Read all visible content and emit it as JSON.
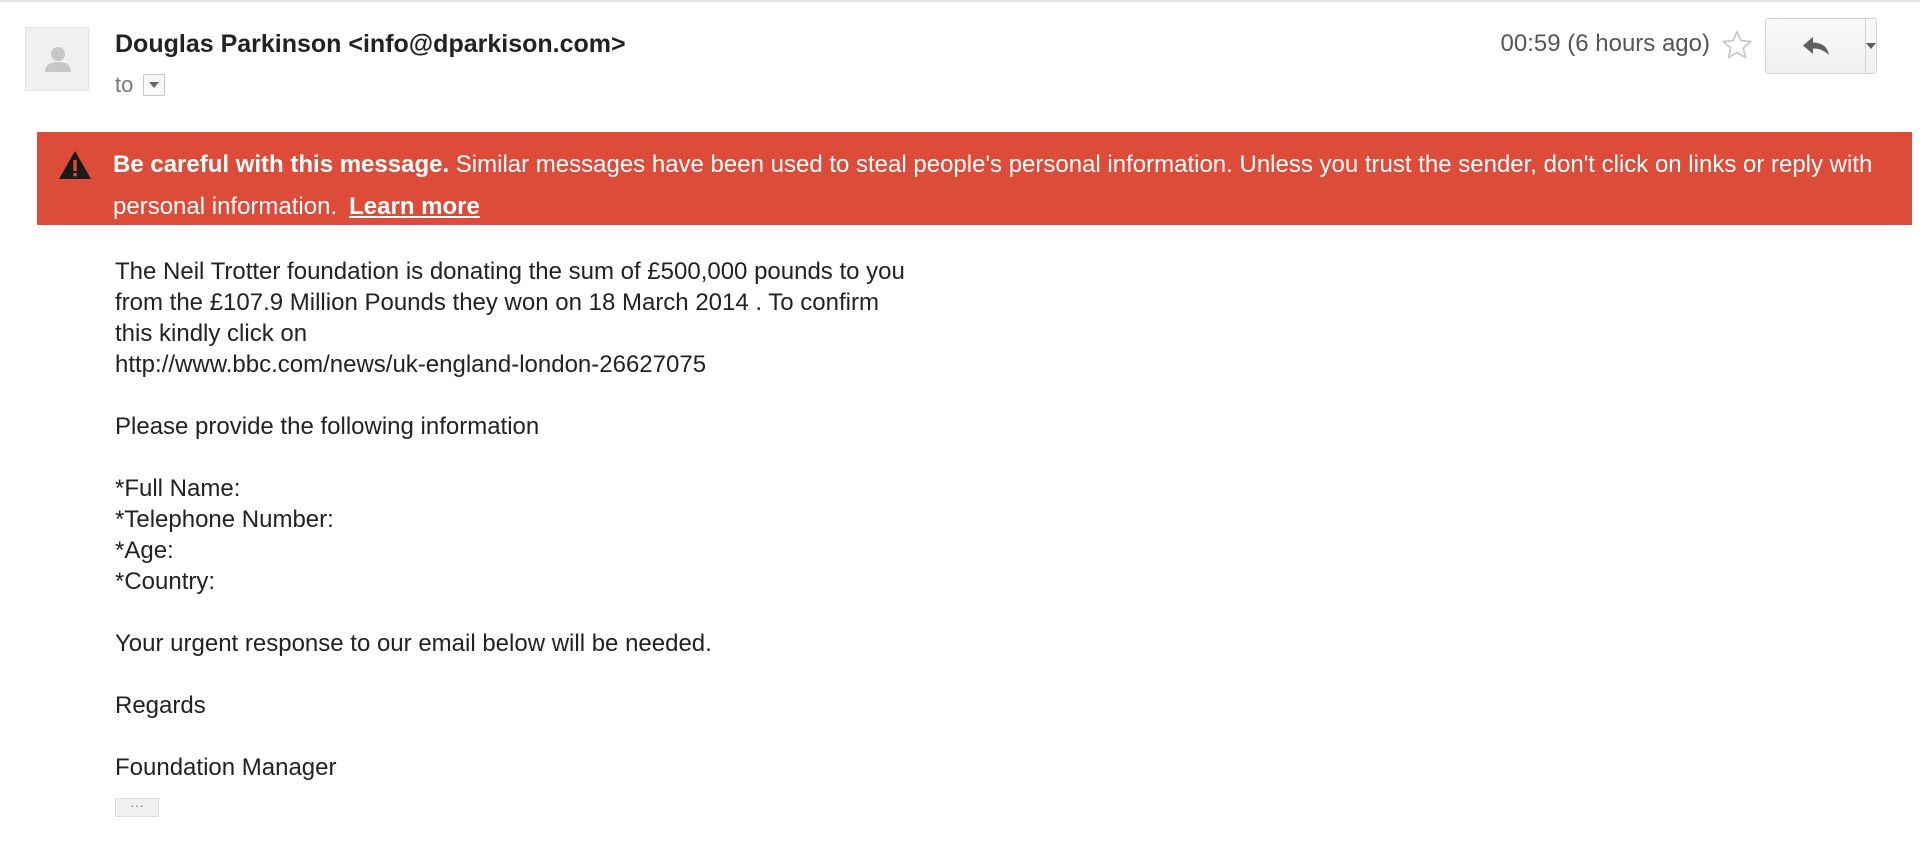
{
  "header": {
    "sender": "Douglas Parkinson <info@dparkison.com>",
    "to_label": "to",
    "timestamp": "00:59 (6 hours ago)"
  },
  "icons": {
    "avatar": "avatar-placeholder-icon",
    "to_dropdown": "chevron-down-icon",
    "star": "star-outline-icon",
    "reply": "reply-icon",
    "more": "caret-down-icon",
    "warning": "warning-triangle-icon"
  },
  "warning": {
    "bold": "Be careful with this message.",
    "text": " Similar messages have been used to steal people's personal information. Unless you trust the sender, don't click on links or reply with personal information.",
    "link": "Learn more",
    "color": "#dd4b39"
  },
  "body": {
    "p1_line1": "The Neil Trotter foundation is donating the sum of £500,000 pounds to you",
    "p1_line2": "from the £107.9 Million Pounds they won on  18 March 2014 . To confirm",
    "p1_line3": "this kindly click on",
    "p1_line4": "http://www.bbc.com/news/uk-england-london-26627075",
    "p2": "Please provide the following information",
    "fields": [
      "*Full Name:",
      "*Telephone Number:",
      "*Age:",
      "*Country:"
    ],
    "p3": "Your urgent response to our email below will be needed.",
    "p4": "Regards",
    "p5": "Foundation Manager",
    "ellipsis": "···"
  }
}
